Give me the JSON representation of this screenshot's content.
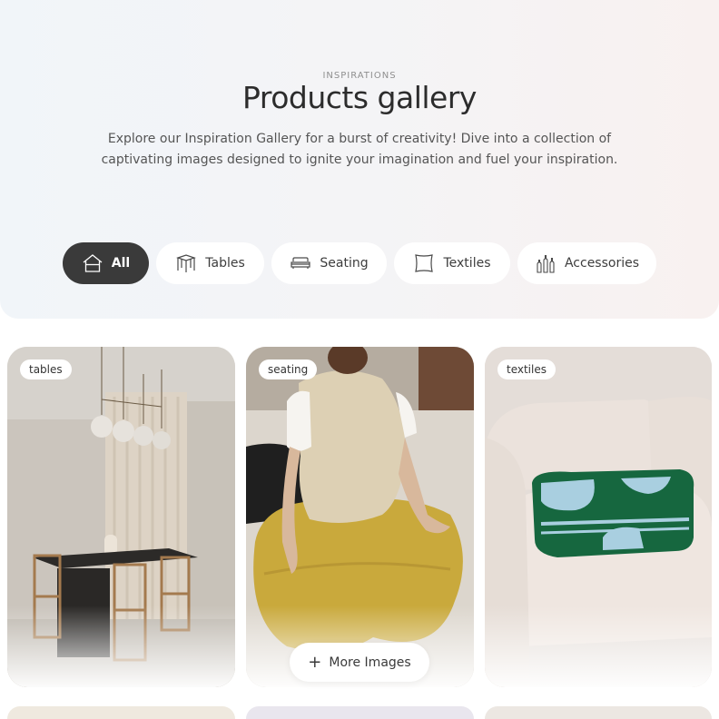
{
  "header": {
    "eyebrow": "INSPIRATIONS",
    "title": "Products gallery",
    "subtitle_line1": "Explore our Inspiration Gallery for a burst of creativity! Dive into a collection of",
    "subtitle_line2": "captivating images designed to ignite your imagination and fuel your inspiration."
  },
  "filters": [
    {
      "label": "All",
      "icon": "house-icon",
      "active": true
    },
    {
      "label": "Tables",
      "icon": "table-icon",
      "active": false
    },
    {
      "label": "Seating",
      "icon": "sofa-icon",
      "active": false
    },
    {
      "label": "Textiles",
      "icon": "pillow-icon",
      "active": false
    },
    {
      "label": "Accessories",
      "icon": "bottles-icon",
      "active": false
    }
  ],
  "gallery": {
    "cards": [
      {
        "tag": "tables",
        "image": "dining-room-photo"
      },
      {
        "tag": "seating",
        "image": "person-on-yellow-pouf-photo"
      },
      {
        "tag": "textiles",
        "image": "folded-blanket-on-sofa-photo"
      }
    ],
    "more_button_label": "More Images"
  },
  "colors": {
    "active_chip": "#3a3a3a",
    "chip_bg": "#ffffff",
    "hero_bg_left": "#f1f5f9",
    "hero_bg_right": "#f8f1f0"
  }
}
